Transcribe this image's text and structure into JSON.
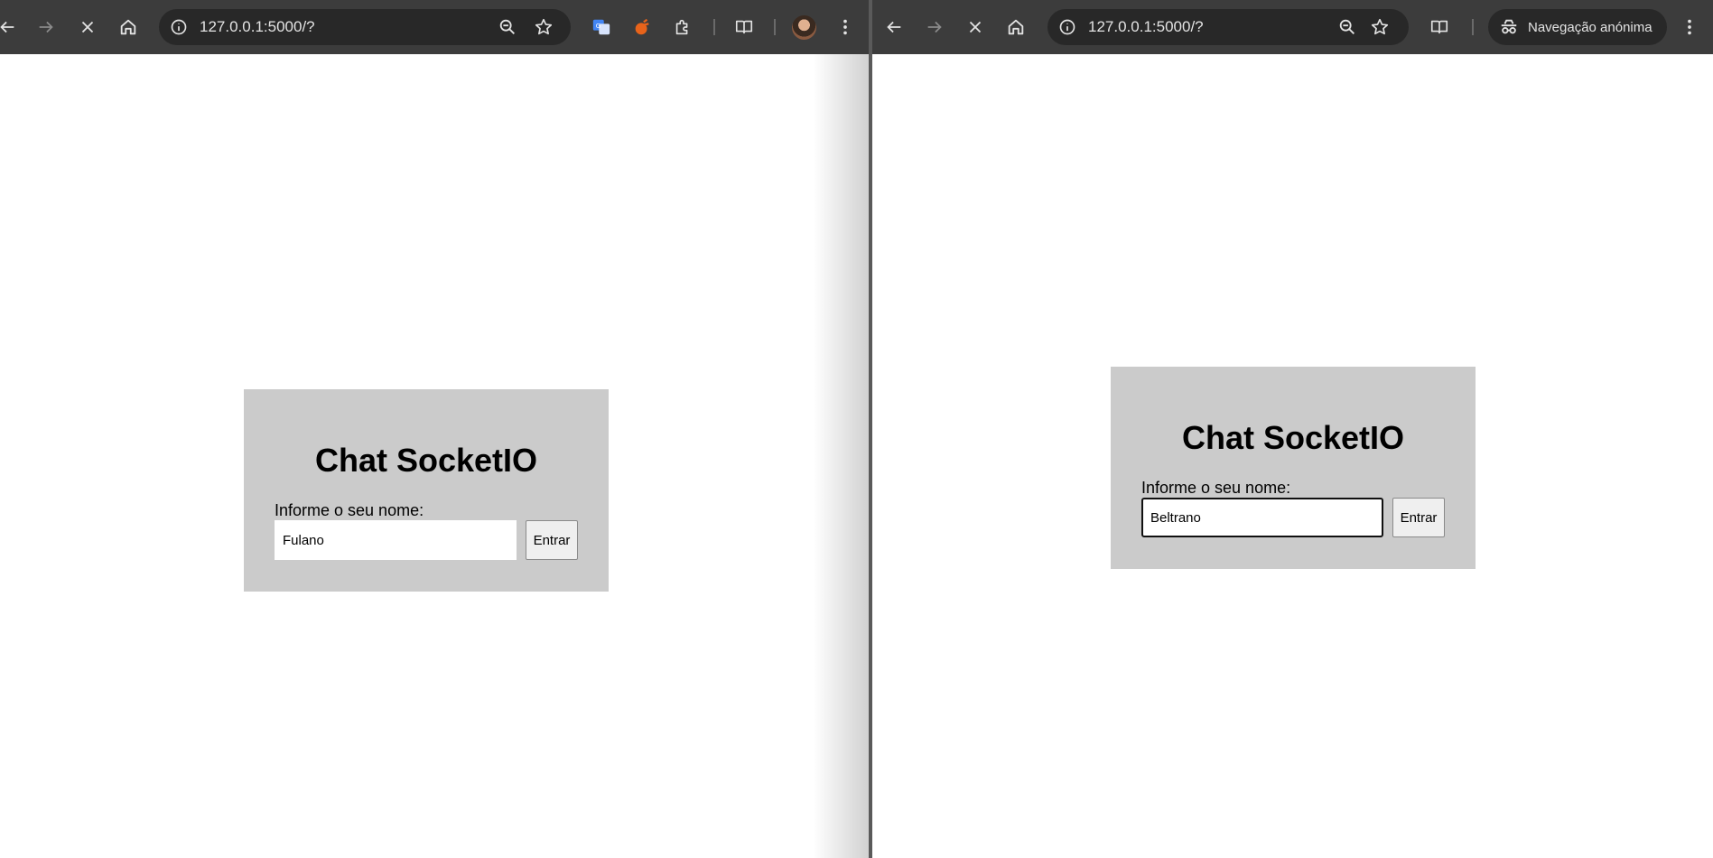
{
  "left_window": {
    "url": "127.0.0.1:5000/?",
    "card": {
      "title": "Chat SocketIO",
      "label": "Informe o seu nome:",
      "input_value": "Fulano",
      "button_label": "Entrar"
    },
    "extensions": [
      "google-translate-icon",
      "orange-extension-icon",
      "extensions-puzzle-icon"
    ]
  },
  "right_window": {
    "url": "127.0.0.1:5000/?",
    "incognito_label": "Navegação anónima",
    "card": {
      "title": "Chat SocketIO",
      "label": "Informe o seu nome:",
      "input_value": "Beltrano",
      "button_label": "Entrar"
    }
  },
  "colors": {
    "toolbar": "#3c3c3c",
    "omnibox": "#282828",
    "card_background": "#cbcbcb",
    "page_background": "#ffffff"
  }
}
